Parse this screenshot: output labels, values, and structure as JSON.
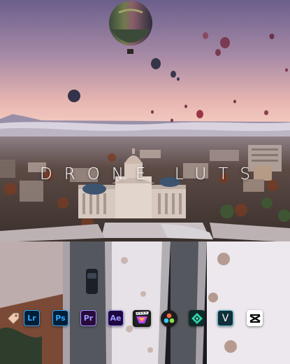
{
  "overlay": {
    "title": "DRONE LUTS"
  },
  "apps": [
    {
      "icon": "lut-tag-icon",
      "label": ""
    },
    {
      "icon": "lightroom-icon",
      "label": "Lr",
      "color": "#31A8FF",
      "bg": "#001E36"
    },
    {
      "icon": "photoshop-icon",
      "label": "Ps",
      "color": "#31A8FF",
      "bg": "#001E36"
    },
    {
      "icon": "premiere-pro-icon",
      "label": "Pr",
      "color": "#9999FF",
      "bg": "#2A0A3A"
    },
    {
      "icon": "after-effects-icon",
      "label": "Ae",
      "color": "#9999FF",
      "bg": "#1F0740"
    },
    {
      "icon": "final-cut-pro-icon",
      "label": ""
    },
    {
      "icon": "davinci-resolve-icon",
      "label": ""
    },
    {
      "icon": "filmora-icon",
      "label": ""
    },
    {
      "icon": "vegas-pro-icon",
      "label": "V",
      "color": "#FFFFFF",
      "bg": "#10303A"
    },
    {
      "icon": "capcut-icon",
      "label": ""
    }
  ]
}
